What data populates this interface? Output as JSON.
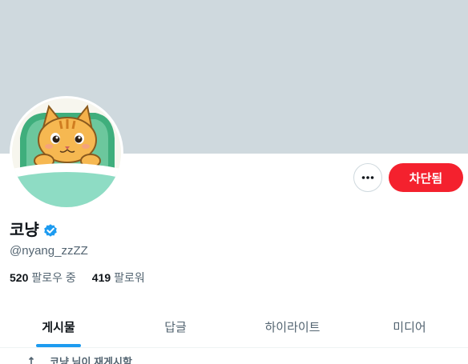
{
  "profile": {
    "display_name": "코냥",
    "handle": "@nyang_zzZZ",
    "verified_icon": "verified-badge-icon",
    "following_count": "520",
    "following_label": "팔로우 중",
    "followers_count": "419",
    "followers_label": "팔로워"
  },
  "actions": {
    "more_icon": "more-horizontal-icon",
    "blocked_label": "차단됨"
  },
  "tabs": [
    {
      "label": "게시물",
      "active": true
    },
    {
      "label": "답글",
      "active": false
    },
    {
      "label": "하이라이트",
      "active": false
    },
    {
      "label": "미디어",
      "active": false
    }
  ],
  "repost_notice": {
    "icon": "repost-icon",
    "text": "코냥 님이 재게시함"
  },
  "colors": {
    "banner": "#cfd9de",
    "accent": "#1d9bf0",
    "blocked": "#f4212e",
    "text_primary": "#0f1419",
    "text_secondary": "#536471"
  }
}
